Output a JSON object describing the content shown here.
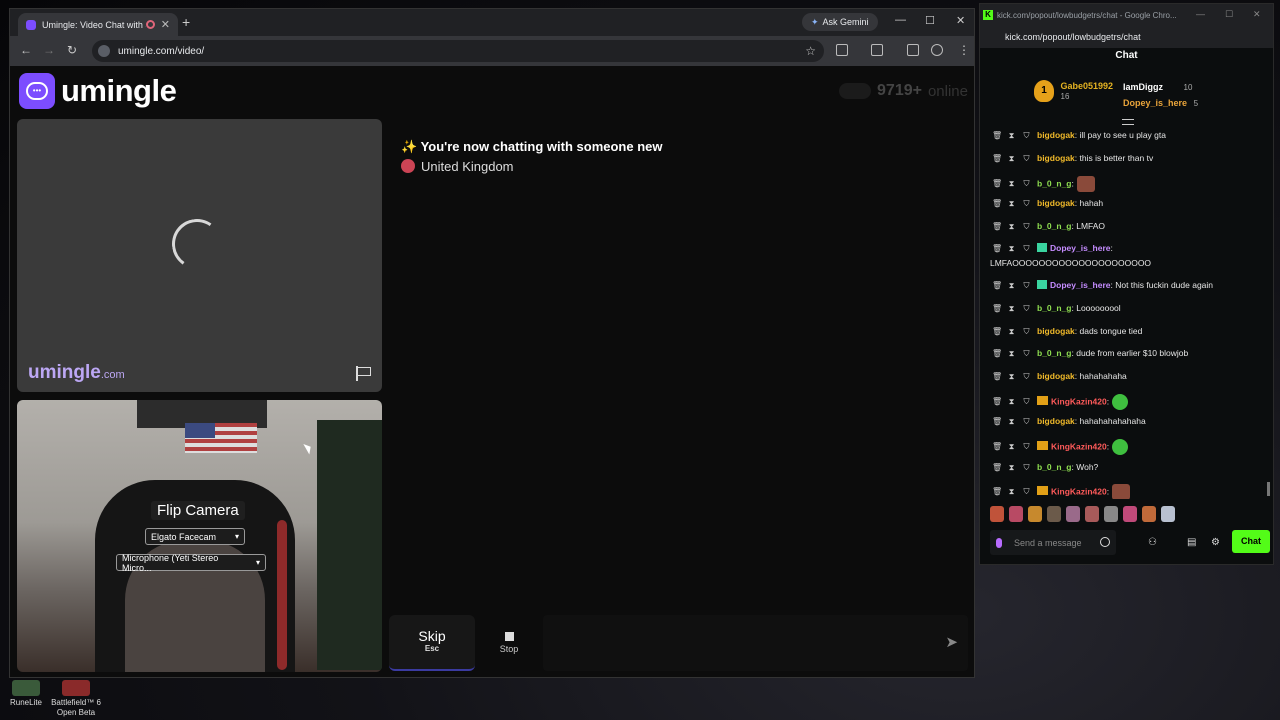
{
  "browser": {
    "tab_title": "Umingle: Video Chat with S",
    "tab_close": "✕",
    "new_tab": "+",
    "ask_gemini": "Ask Gemini",
    "url": "umingle.com/video/"
  },
  "site": {
    "logo_text": "umingle",
    "online_count": "9719+",
    "online_label": "online",
    "watermark_main": "umingle",
    "watermark_suffix": ".com",
    "flip_camera": "Flip Camera",
    "camera_select": "Elgato Facecam",
    "mic_select": "Microphone (Yeti Stereo Micro...",
    "now_chatting": "✨ You're now chatting with someone new",
    "country": "United Kingdom",
    "skip_label": "Skip",
    "skip_key": "Esc",
    "stop_label": "Stop"
  },
  "chat_window": {
    "title": "kick.com/popout/lowbudgetrs/chat - Google Chro...",
    "url": "kick.com/popout/lowbudgetrs/chat",
    "header": "Chat",
    "leaderboard": [
      {
        "rank": "1",
        "name": "Gabe051992",
        "count": "16",
        "color": "#e6b422"
      },
      {
        "name": "IamDiggz",
        "count": "10",
        "color": "#ffffff"
      },
      {
        "name": "Dopey_is_here",
        "count": "5",
        "color": "#e9a43a"
      }
    ],
    "messages": [
      {
        "user": "bigdogak",
        "text": ": ill pay to see u play gta",
        "color": "#f0b92a"
      },
      {
        "user": "bigdogak",
        "text": ": this is better than tv",
        "color": "#f0b92a"
      },
      {
        "user": "b_0_n_g",
        "text": ":",
        "color": "#8fdf50",
        "emote": "face"
      },
      {
        "user": "bigdogak",
        "text": ": hahah",
        "color": "#f0b92a"
      },
      {
        "user": "b_0_n_g",
        "text": ": LMFAO",
        "color": "#8fdf50"
      },
      {
        "user": "Dopey_is_here",
        "text": ":",
        "color": "#c58cff",
        "badge": "gift"
      },
      {
        "user": "",
        "text": "LMFAOOOOOOOOOOOOOOOOOOOOO",
        "color": "#ffffff"
      },
      {
        "user": "Dopey_is_here",
        "text": ": Not this fuckin dude again",
        "color": "#c58cff",
        "badge": "gift"
      },
      {
        "user": "b_0_n_g",
        "text": ": Looooooool",
        "color": "#8fdf50"
      },
      {
        "user": "bigdogak",
        "text": ": dads tongue tied",
        "color": "#f0b92a"
      },
      {
        "user": "b_0_n_g",
        "text": ": dude from earlier $10 blowjob",
        "color": "#8fdf50"
      },
      {
        "user": "bigdogak",
        "text": ": hahahahaha",
        "color": "#f0b92a"
      },
      {
        "user": "KingKazin420",
        "text": ":",
        "color": "#ff5a5a",
        "badge": "crown",
        "emote": "green"
      },
      {
        "user": "bigdogak",
        "text": ": hahahahahahaha",
        "color": "#f0b92a"
      },
      {
        "user": "KingKazin420",
        "text": ":",
        "color": "#ff5a5a",
        "badge": "crown",
        "emote": "green"
      },
      {
        "user": "b_0_n_g",
        "text": ": Woh?",
        "color": "#8fdf50"
      },
      {
        "user": "KingKazin420",
        "text": ":",
        "color": "#ff5a5a",
        "badge": "crown",
        "emote": "face"
      }
    ],
    "input_placeholder": "Send a message",
    "chat_button": "Chat"
  },
  "desktop": {
    "icons": [
      {
        "label": "RuneLite"
      },
      {
        "label": "Battlefield™ 6 Open Beta"
      }
    ]
  },
  "colors": {
    "umingle_purple": "#7c4dff",
    "kick_green": "#53fc18"
  }
}
